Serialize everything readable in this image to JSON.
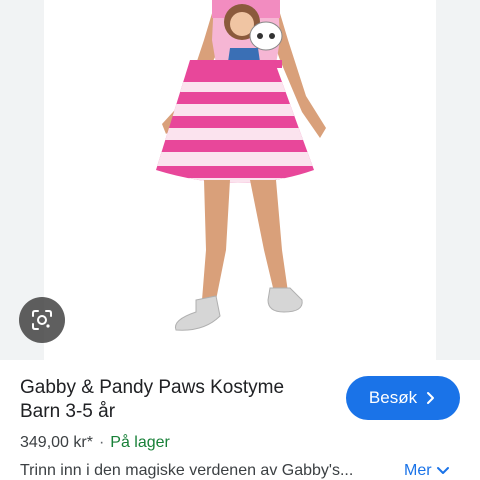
{
  "product": {
    "title_line1": "Gabby & Pandy Paws Kostyme",
    "title_line2": "Barn 3-5 år",
    "price": "349,00 kr*",
    "separator": "·",
    "stock": "På lager",
    "description": "Trinn inn i den magiske verdenen av Gabby's..."
  },
  "actions": {
    "visit_label": "Besøk",
    "more_label": "Mer"
  },
  "icons": {
    "lens": "google-lens-icon",
    "visit_arrow": "chevron-right-icon",
    "more_arrow": "chevron-down-icon"
  },
  "colors": {
    "accent": "#1a73e8",
    "stock": "#188038",
    "dress_pink": "#e8479a"
  }
}
